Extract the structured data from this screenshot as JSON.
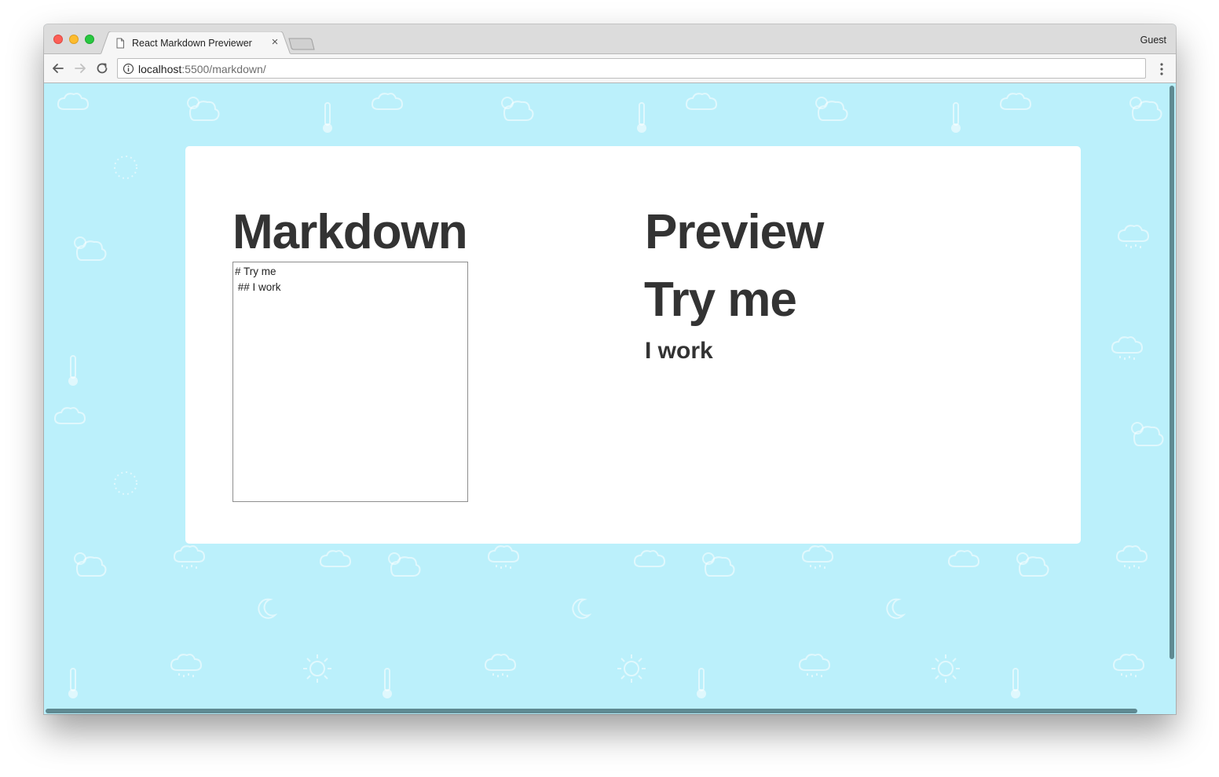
{
  "browser": {
    "tab_title": "React Markdown Previewer",
    "tab_close": "×",
    "profile": "Guest",
    "url_host": "localhost",
    "url_rest": ":5500/markdown/"
  },
  "page": {
    "markdown_title": "Markdown",
    "preview_title": "Preview",
    "editor_value": "# Try me\n ## I work",
    "preview_h1": "Try me",
    "preview_h2": "I work"
  },
  "colors": {
    "background": "#bbf0fb",
    "card": "#ffffff",
    "heading_text": "#333333",
    "scrollbar": "#5f8a92"
  },
  "icons": [
    "page-icon",
    "back-arrow-icon",
    "forward-arrow-icon",
    "reload-icon",
    "info-icon",
    "kebab-menu-icon",
    "cloud-icon",
    "thermometer-icon",
    "sun-icon",
    "moon-icon"
  ]
}
